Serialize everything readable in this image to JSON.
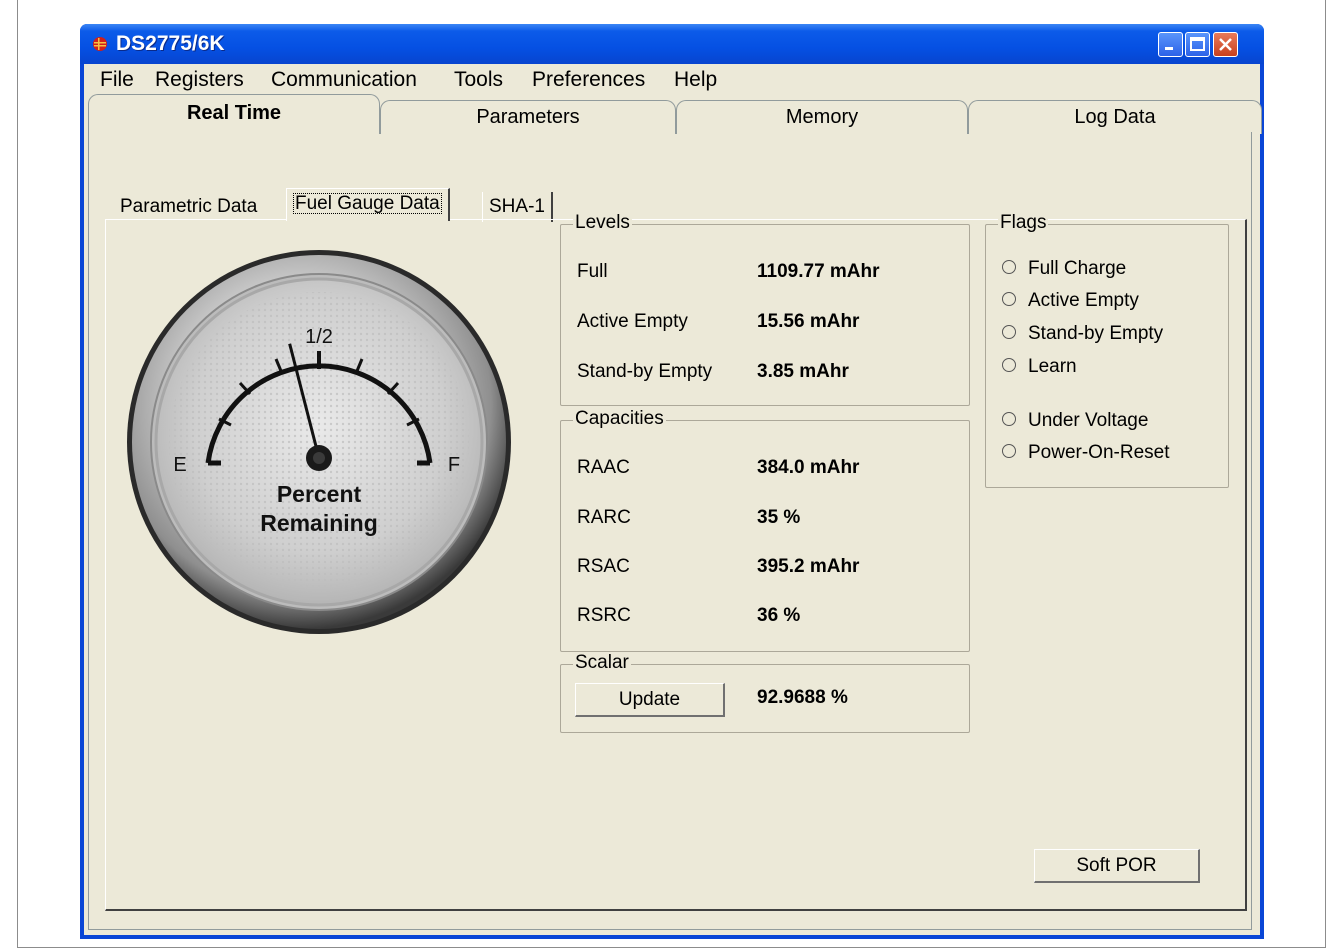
{
  "window": {
    "title": "DS2775/6K"
  },
  "menu": [
    "File",
    "Registers",
    "Communication",
    "Tools",
    "Preferences",
    "Help"
  ],
  "main_tabs": [
    "Real Time",
    "Parameters",
    "Memory",
    "Log Data"
  ],
  "sub_tabs": [
    "Parametric Data",
    "Fuel Gauge Data",
    "SHA-1"
  ],
  "gauge": {
    "half_label": "1/2",
    "empty_label": "E",
    "full_label": "F",
    "caption_line1": "Percent",
    "caption_line2": "Remaining",
    "needle_fraction": 0.42
  },
  "levels": {
    "title": "Levels",
    "rows": [
      {
        "label": "Full",
        "value": "1109.77 mAhr"
      },
      {
        "label": "Active Empty",
        "value": "15.56 mAhr"
      },
      {
        "label": "Stand-by Empty",
        "value": "3.85 mAhr"
      }
    ]
  },
  "capacities": {
    "title": "Capacities",
    "rows": [
      {
        "label": "RAAC",
        "value": "384.0 mAhr"
      },
      {
        "label": "RARC",
        "value": "35 %"
      },
      {
        "label": "RSAC",
        "value": "395.2 mAhr"
      },
      {
        "label": "RSRC",
        "value": "36 %"
      }
    ]
  },
  "scalar": {
    "title": "Scalar",
    "button": "Update",
    "value": "92.9688 %"
  },
  "flags": {
    "title": "Flags",
    "items": [
      "Full Charge",
      "Active Empty",
      "Stand-by Empty",
      "Learn",
      "Under Voltage",
      "Power-On-Reset"
    ]
  },
  "soft_por_button": "Soft POR"
}
